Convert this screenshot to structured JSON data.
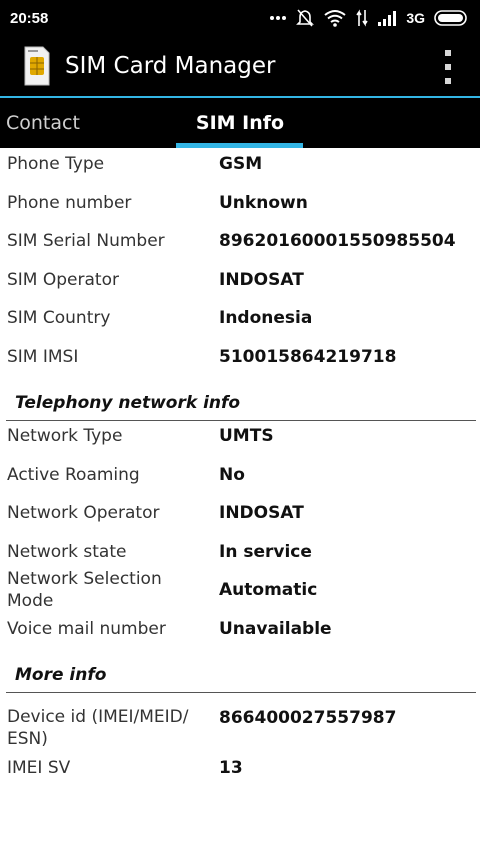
{
  "status_bar": {
    "time": "20:58",
    "network": "3G",
    "icons": [
      "more-dots-icon",
      "mute-icon",
      "wifi-icon",
      "data-arrows-icon",
      "signal-icon",
      "battery-icon"
    ]
  },
  "app": {
    "title": "SIM Card Manager",
    "accent": "#33b5e5"
  },
  "tabs": [
    {
      "label": "Contact",
      "active": false
    },
    {
      "label": "SIM Info",
      "active": true
    }
  ],
  "sim_info": [
    {
      "label": "Phone Type",
      "value": "GSM"
    },
    {
      "label": "Phone number",
      "value": "Unknown"
    },
    {
      "label": "SIM Serial Number",
      "value": "89620160001550985504"
    },
    {
      "label": "SIM Operator",
      "value": "INDOSAT"
    },
    {
      "label": "SIM Country",
      "value": "Indonesia"
    },
    {
      "label": "SIM IMSI",
      "value": "510015864219718"
    }
  ],
  "telephony": {
    "title": "Telephony network info",
    "rows": [
      {
        "label": "Network Type",
        "value": "UMTS"
      },
      {
        "label": "Active Roaming",
        "value": "No"
      },
      {
        "label": "Network Operator",
        "value": "INDOSAT"
      },
      {
        "label": "Network state",
        "value": "In service"
      },
      {
        "label": "Network Selection Mode",
        "value": "Automatic"
      },
      {
        "label": "Voice mail number",
        "value": "Unavailable"
      }
    ]
  },
  "more_info": {
    "title": "More info",
    "rows": [
      {
        "label": "Device id (IMEI/MEID/ ESN)",
        "value": "866400027557987"
      },
      {
        "label": "IMEI SV",
        "value": "13"
      }
    ]
  }
}
